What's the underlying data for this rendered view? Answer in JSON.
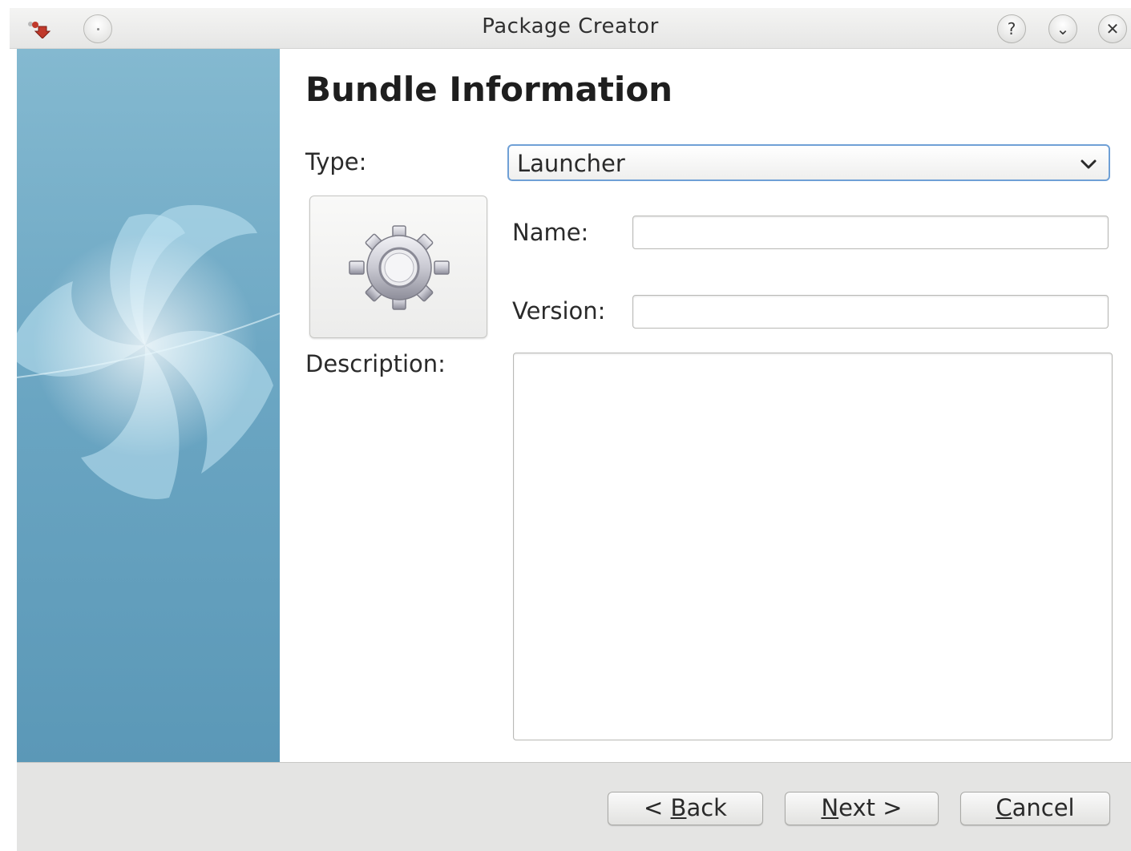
{
  "window": {
    "title": "Package Creator",
    "help_glyph": "?",
    "minimize_glyph": "⌄",
    "close_glyph": "✕"
  },
  "page": {
    "title": "Bundle Information"
  },
  "form": {
    "type_label": "Type:",
    "type_value": "Launcher",
    "name_label": "Name:",
    "name_value": "",
    "version_label": "Version:",
    "version_value": "",
    "description_label": "Description:",
    "description_value": ""
  },
  "icon": {
    "semantic": "gear-icon"
  },
  "buttons": {
    "back_prefix": "< ",
    "back_mnemonic": "B",
    "back_rest": "ack",
    "next_mnemonic": "N",
    "next_rest": "ext >",
    "cancel_mnemonic": "C",
    "cancel_rest": "ancel"
  },
  "colors": {
    "side_panel": "#6aa5c2",
    "focus_border": "#6fa0d6",
    "footer": "#e4e4e3"
  }
}
